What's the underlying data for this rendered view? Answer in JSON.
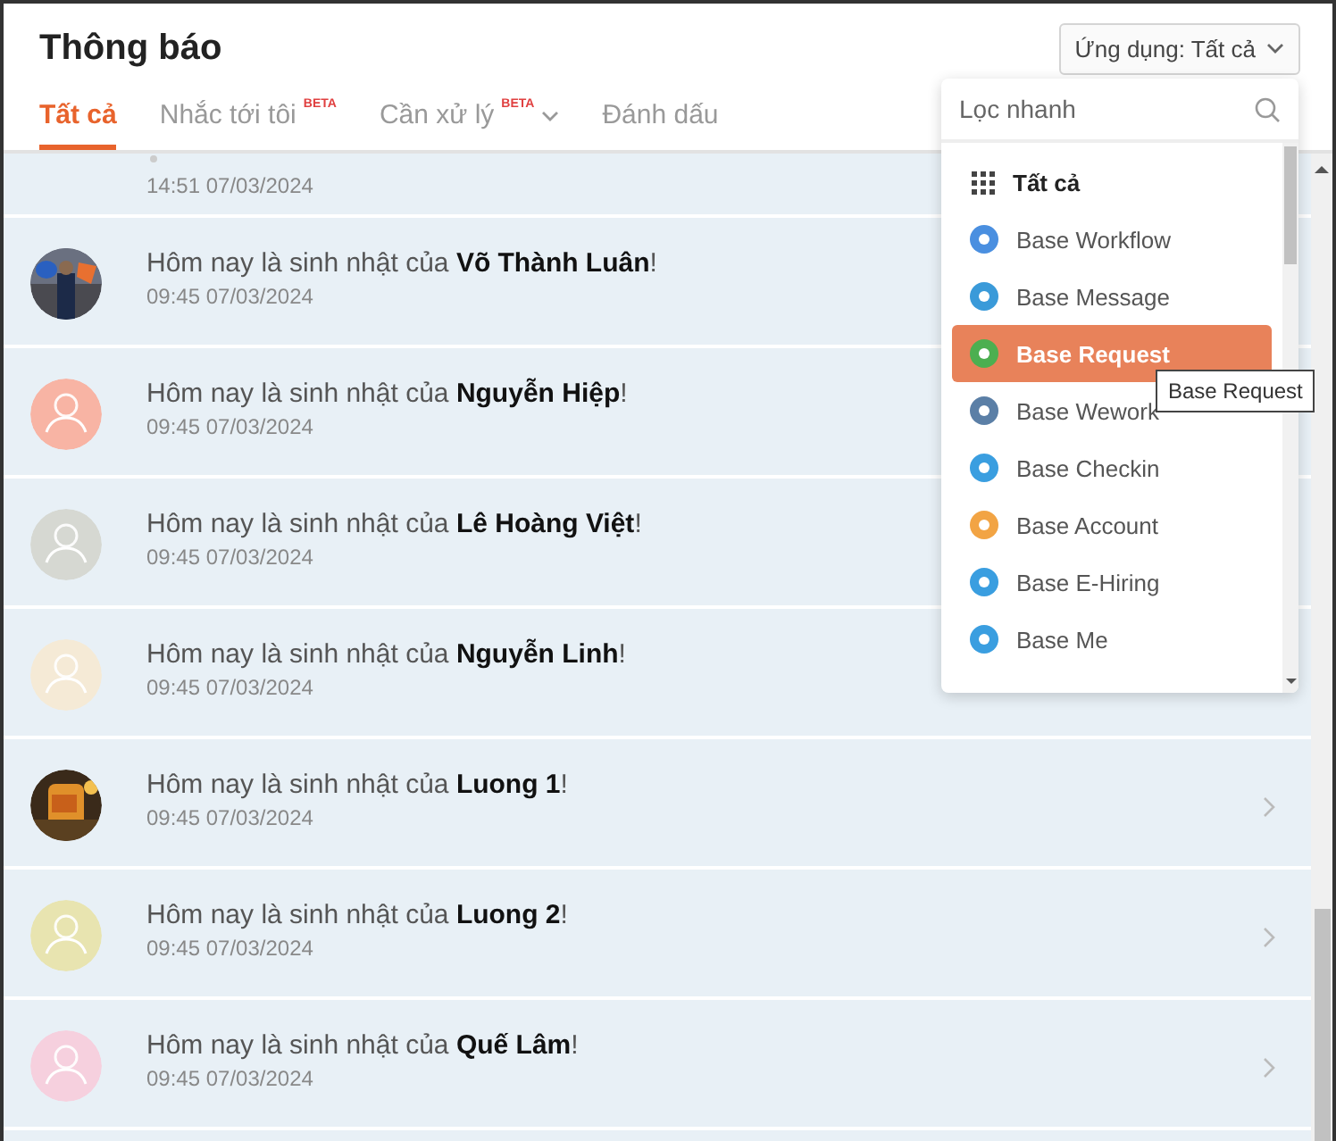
{
  "header": {
    "title": "Thông báo",
    "app_filter": "Ứng dụng: Tất cả"
  },
  "tabs": [
    {
      "label": "Tất cả",
      "selected": true
    },
    {
      "label": "Nhắc tới tôi",
      "badge": "BETA",
      "selected": false
    },
    {
      "label": "Cần xử lý",
      "badge": "BETA",
      "dropdown": true,
      "selected": false
    },
    {
      "label": "Đánh dấu",
      "selected": false
    }
  ],
  "partial_row": {
    "time": "14:51 07/03/2024"
  },
  "notifications": [
    {
      "message": "Hôm nay là sinh nhật của **Võ Thành Luân**!",
      "time": "09:45 07/03/2024",
      "chevron": false
    },
    {
      "message": "Hôm nay là sinh nhật của **Nguyễn Hiệp**!",
      "time": "09:45 07/03/2024",
      "avatar": {
        "kind": "placeholder",
        "color": "#f8b4a4"
      },
      "chevron": false
    },
    {
      "message": "Hôm nay là sinh nhật của **Lê Hoàng Việt**!",
      "time": "09:45 07/03/2024",
      "avatar": {
        "kind": "placeholder",
        "color": "#d6d8d2"
      },
      "chevron": false
    },
    {
      "message": "Hôm nay là sinh nhật của **Nguyễn Linh**!",
      "time": "09:45 07/03/2024",
      "avatar": {
        "kind": "placeholder",
        "color": "#f5ead6"
      },
      "chevron": false
    },
    {
      "message": "Hôm nay là sinh nhật của **Luong 1**!",
      "time": "09:45 07/03/2024",
      "chevron": true
    },
    {
      "message": "Hôm nay là sinh nhật của **Luong 2**!",
      "time": "09:45 07/03/2024",
      "avatar": {
        "kind": "placeholder",
        "color": "#e8e4b0"
      },
      "chevron": true
    },
    {
      "message": "Hôm nay là sinh nhật của **Quế Lâm**!",
      "time": "09:45 07/03/2024",
      "avatar": {
        "kind": "placeholder",
        "color": "#f6d0de"
      },
      "chevron": true
    }
  ],
  "app_menu": {
    "search": {
      "placeholder": "Lọc nhanh"
    },
    "items": [
      {
        "label": "Tất cả",
        "kind": "all",
        "selected": false
      },
      {
        "label": "Base Workflow",
        "kind": "app",
        "color": "#4a8fe0",
        "selected": false
      },
      {
        "label": "Base Message",
        "kind": "app",
        "color": "#3a9ad9",
        "selected": false
      },
      {
        "label": "Base Request",
        "kind": "app",
        "color": "#4caf50",
        "selected": true
      },
      {
        "label": "Base Wework",
        "kind": "app",
        "color": "#5b7fa6",
        "selected": false
      },
      {
        "label": "Base Checkin",
        "kind": "app",
        "color": "#3a9ee0",
        "selected": false
      },
      {
        "label": "Base Account",
        "kind": "app",
        "color": "#f2a444",
        "selected": false
      },
      {
        "label": "Base E-Hiring",
        "kind": "app",
        "color": "#3a9ee0",
        "selected": false
      },
      {
        "label": "Base Me",
        "kind": "app",
        "color": "#3a9ee0",
        "selected": false
      }
    ],
    "tooltip": "Base Request"
  }
}
